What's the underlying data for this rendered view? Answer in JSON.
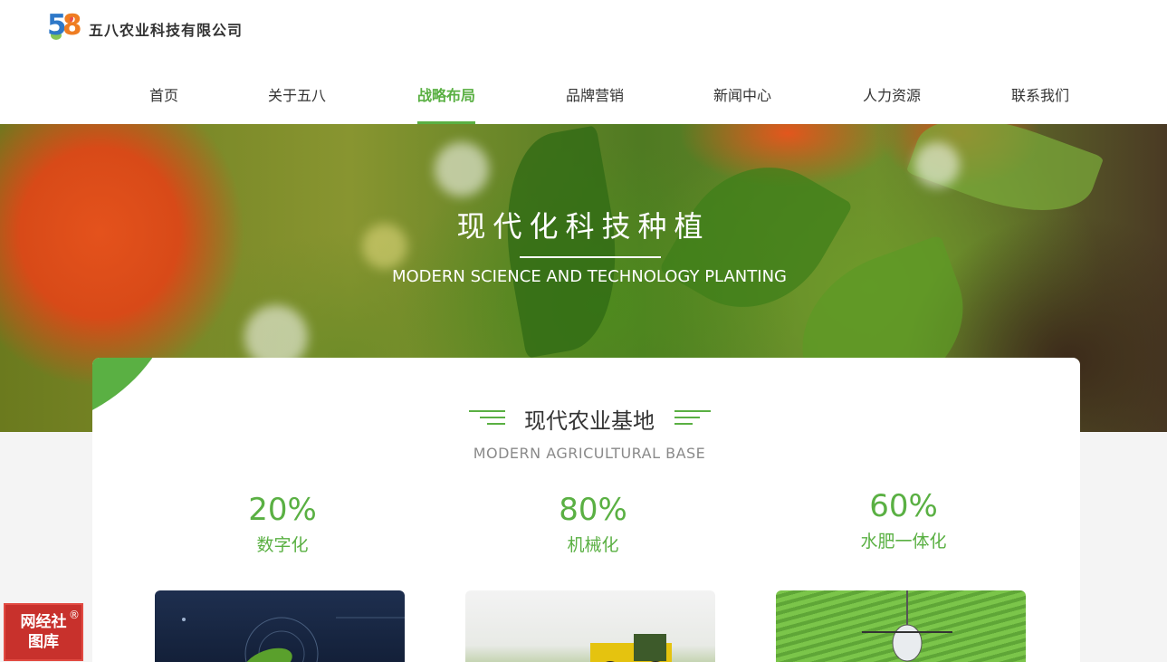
{
  "header": {
    "company_name": "五八农业科技有限公司",
    "nav": [
      {
        "label": "首页"
      },
      {
        "label": "关于五八"
      },
      {
        "label": "战略布局",
        "active": true
      },
      {
        "label": "品牌营销"
      },
      {
        "label": "新闻中心"
      },
      {
        "label": "人力资源"
      },
      {
        "label": "联系我们"
      }
    ]
  },
  "hero": {
    "title": "现代化科技种植",
    "subtitle": "MODERN SCIENCE AND TECHNOLOGY PLANTING"
  },
  "section": {
    "title": "现代农业基地",
    "subtitle": "MODERN AGRICULTURAL BASE",
    "stats": [
      {
        "value": "20%",
        "label": "数字化"
      },
      {
        "value": "80%",
        "label": "机械化"
      },
      {
        "value": "60%",
        "label": "水肥一体化"
      }
    ]
  },
  "watermark": {
    "line1": "网经社",
    "line2": "图库",
    "reg": "®"
  },
  "colors": {
    "accent": "#5ab043",
    "text": "#333333",
    "muted": "#8a8a8a"
  }
}
